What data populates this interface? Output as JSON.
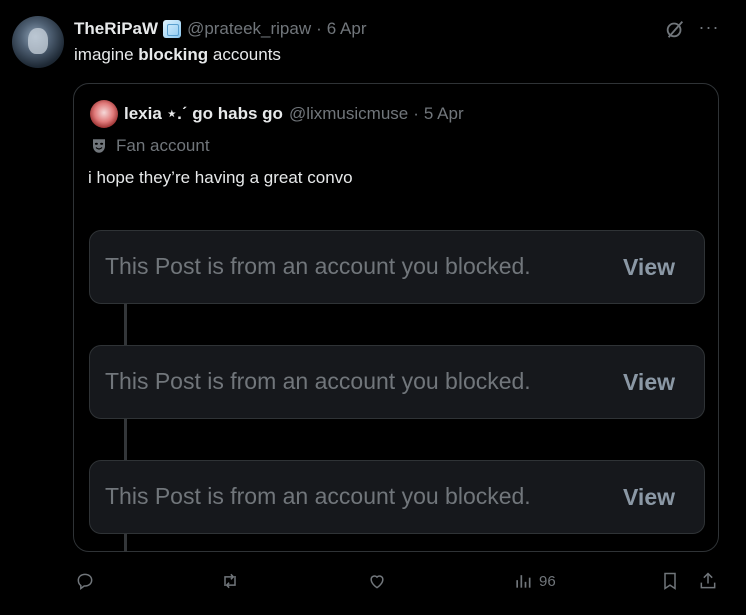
{
  "post": {
    "author_name": "TheRiPaW",
    "handle": "@prateek_ripaw",
    "separator": "·",
    "date": "6 Apr",
    "text_before": "imagine ",
    "text_bold": "blocking",
    "text_after": " accounts",
    "more_label": "···"
  },
  "quote": {
    "author_name": "lexia ⋆.ˊ go habs go",
    "handle": "@lixmusicmuse",
    "separator": "·",
    "date": "5 Apr",
    "label": "Fan account",
    "text": "i hope they’re having a great convo",
    "blocked_items": [
      {
        "message": "This Post is from an account you blocked.",
        "action": "View"
      },
      {
        "message": "This Post is from an account you blocked.",
        "action": "View"
      },
      {
        "message": "This Post is from an account you blocked.",
        "action": "View"
      }
    ]
  },
  "actions": {
    "views_count": "96"
  },
  "colors": {
    "background": "#000000",
    "text": "#e7e9ea",
    "muted": "#71767b",
    "border": "#2f3336",
    "blocked_bg": "#16181c"
  }
}
